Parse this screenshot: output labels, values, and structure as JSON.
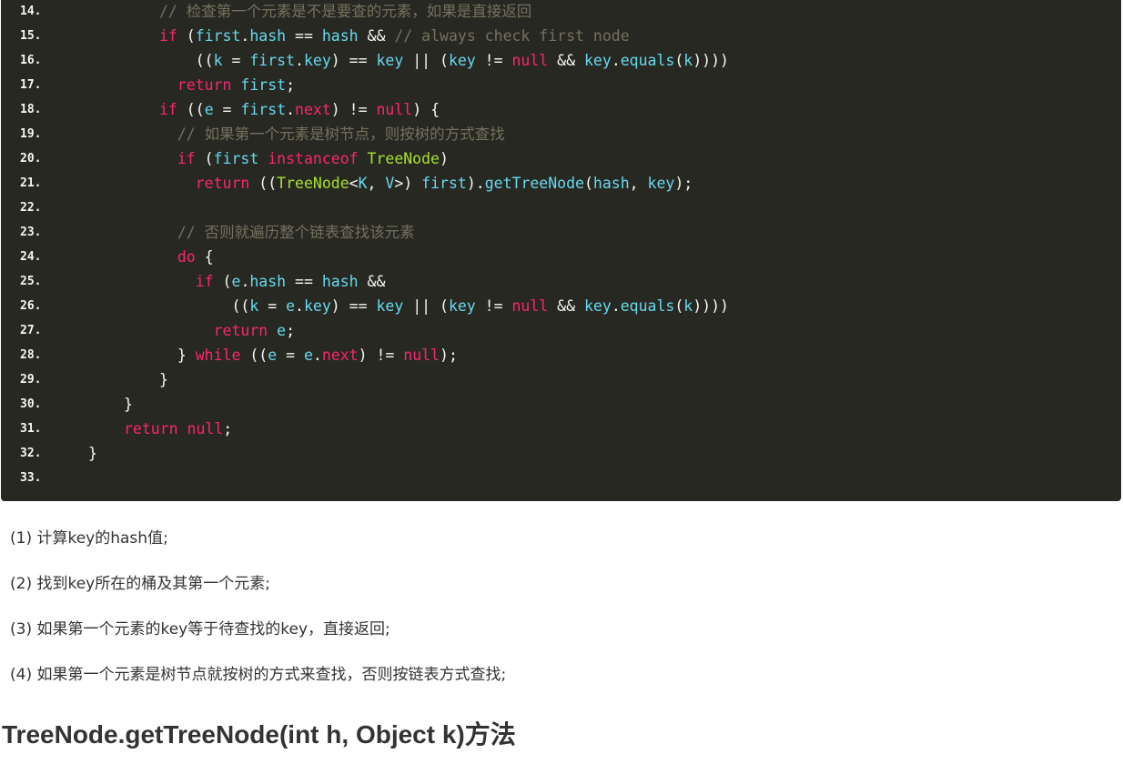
{
  "code": {
    "lines": [
      {
        "n": "14.",
        "tokens": [
          {
            "c": "c",
            "t": "// 检查第一个元素是不是要查的元素，如果是直接返回"
          }
        ]
      },
      {
        "n": "15.",
        "tokens": [
          {
            "c": "k",
            "t": "if"
          },
          {
            "c": "p",
            "t": " ("
          },
          {
            "c": "v",
            "t": "first"
          },
          {
            "c": "p",
            "t": "."
          },
          {
            "c": "v",
            "t": "hash"
          },
          {
            "c": "p",
            "t": " == "
          },
          {
            "c": "v",
            "t": "hash"
          },
          {
            "c": "p",
            "t": " && "
          },
          {
            "c": "c",
            "t": "// always check first node"
          }
        ]
      },
      {
        "n": "16.",
        "tokens": [
          {
            "c": "p",
            "t": "    (("
          },
          {
            "c": "v",
            "t": "k"
          },
          {
            "c": "p",
            "t": " = "
          },
          {
            "c": "v",
            "t": "first"
          },
          {
            "c": "p",
            "t": "."
          },
          {
            "c": "v",
            "t": "key"
          },
          {
            "c": "p",
            "t": ") == "
          },
          {
            "c": "v",
            "t": "key"
          },
          {
            "c": "p",
            "t": " || ("
          },
          {
            "c": "v",
            "t": "key"
          },
          {
            "c": "p",
            "t": " != "
          },
          {
            "c": "k",
            "t": "null"
          },
          {
            "c": "p",
            "t": " && "
          },
          {
            "c": "v",
            "t": "key"
          },
          {
            "c": "p",
            "t": "."
          },
          {
            "c": "v",
            "t": "equals"
          },
          {
            "c": "p",
            "t": "("
          },
          {
            "c": "v",
            "t": "k"
          },
          {
            "c": "p",
            "t": "))))"
          }
        ]
      },
      {
        "n": "17.",
        "tokens": [
          {
            "c": "p",
            "t": "  "
          },
          {
            "c": "k",
            "t": "return"
          },
          {
            "c": "p",
            "t": " "
          },
          {
            "c": "v",
            "t": "first"
          },
          {
            "c": "p",
            "t": ";"
          }
        ]
      },
      {
        "n": "18.",
        "tokens": [
          {
            "c": "k",
            "t": "if"
          },
          {
            "c": "p",
            "t": " (("
          },
          {
            "c": "v",
            "t": "e"
          },
          {
            "c": "p",
            "t": " = "
          },
          {
            "c": "v",
            "t": "first"
          },
          {
            "c": "p",
            "t": "."
          },
          {
            "c": "k",
            "t": "next"
          },
          {
            "c": "p",
            "t": ") != "
          },
          {
            "c": "k",
            "t": "null"
          },
          {
            "c": "p",
            "t": ") {"
          }
        ]
      },
      {
        "n": "19.",
        "tokens": [
          {
            "c": "p",
            "t": "  "
          },
          {
            "c": "c",
            "t": "// 如果第一个元素是树节点，则按树的方式查找"
          }
        ]
      },
      {
        "n": "20.",
        "tokens": [
          {
            "c": "p",
            "t": "  "
          },
          {
            "c": "k",
            "t": "if"
          },
          {
            "c": "p",
            "t": " ("
          },
          {
            "c": "v",
            "t": "first"
          },
          {
            "c": "p",
            "t": " "
          },
          {
            "c": "k",
            "t": "instanceof"
          },
          {
            "c": "p",
            "t": " "
          },
          {
            "c": "t",
            "t": "TreeNode"
          },
          {
            "c": "p",
            "t": ")"
          }
        ]
      },
      {
        "n": "21.",
        "tokens": [
          {
            "c": "p",
            "t": "    "
          },
          {
            "c": "k",
            "t": "return"
          },
          {
            "c": "p",
            "t": " (("
          },
          {
            "c": "t",
            "t": "TreeNode"
          },
          {
            "c": "p",
            "t": "<"
          },
          {
            "c": "v",
            "t": "K"
          },
          {
            "c": "p",
            "t": ", "
          },
          {
            "c": "v",
            "t": "V"
          },
          {
            "c": "p",
            "t": ">) "
          },
          {
            "c": "v",
            "t": "first"
          },
          {
            "c": "p",
            "t": ")."
          },
          {
            "c": "v",
            "t": "getTreeNode"
          },
          {
            "c": "p",
            "t": "("
          },
          {
            "c": "v",
            "t": "hash"
          },
          {
            "c": "p",
            "t": ", "
          },
          {
            "c": "v",
            "t": "key"
          },
          {
            "c": "p",
            "t": ");"
          }
        ]
      },
      {
        "n": "22.",
        "tokens": []
      },
      {
        "n": "23.",
        "tokens": [
          {
            "c": "p",
            "t": "  "
          },
          {
            "c": "c",
            "t": "// 否则就遍历整个链表查找该元素"
          }
        ]
      },
      {
        "n": "24.",
        "tokens": [
          {
            "c": "p",
            "t": "  "
          },
          {
            "c": "k",
            "t": "do"
          },
          {
            "c": "p",
            "t": " {"
          }
        ]
      },
      {
        "n": "25.",
        "tokens": [
          {
            "c": "p",
            "t": "    "
          },
          {
            "c": "k",
            "t": "if"
          },
          {
            "c": "p",
            "t": " ("
          },
          {
            "c": "v",
            "t": "e"
          },
          {
            "c": "p",
            "t": "."
          },
          {
            "c": "v",
            "t": "hash"
          },
          {
            "c": "p",
            "t": " == "
          },
          {
            "c": "v",
            "t": "hash"
          },
          {
            "c": "p",
            "t": " &&"
          }
        ]
      },
      {
        "n": "26.",
        "tokens": [
          {
            "c": "p",
            "t": "        (("
          },
          {
            "c": "v",
            "t": "k"
          },
          {
            "c": "p",
            "t": " = "
          },
          {
            "c": "v",
            "t": "e"
          },
          {
            "c": "p",
            "t": "."
          },
          {
            "c": "v",
            "t": "key"
          },
          {
            "c": "p",
            "t": ") == "
          },
          {
            "c": "v",
            "t": "key"
          },
          {
            "c": "p",
            "t": " || ("
          },
          {
            "c": "v",
            "t": "key"
          },
          {
            "c": "p",
            "t": " != "
          },
          {
            "c": "k",
            "t": "null"
          },
          {
            "c": "p",
            "t": " && "
          },
          {
            "c": "v",
            "t": "key"
          },
          {
            "c": "p",
            "t": "."
          },
          {
            "c": "v",
            "t": "equals"
          },
          {
            "c": "p",
            "t": "("
          },
          {
            "c": "v",
            "t": "k"
          },
          {
            "c": "p",
            "t": "))))"
          }
        ]
      },
      {
        "n": "27.",
        "tokens": [
          {
            "c": "p",
            "t": "      "
          },
          {
            "c": "k",
            "t": "return"
          },
          {
            "c": "p",
            "t": " "
          },
          {
            "c": "v",
            "t": "e"
          },
          {
            "c": "p",
            "t": ";"
          }
        ]
      },
      {
        "n": "28.",
        "tokens": [
          {
            "c": "p",
            "t": "  } "
          },
          {
            "c": "k",
            "t": "while"
          },
          {
            "c": "p",
            "t": " (("
          },
          {
            "c": "v",
            "t": "e"
          },
          {
            "c": "p",
            "t": " = "
          },
          {
            "c": "v",
            "t": "e"
          },
          {
            "c": "p",
            "t": "."
          },
          {
            "c": "k",
            "t": "next"
          },
          {
            "c": "p",
            "t": ") != "
          },
          {
            "c": "k",
            "t": "null"
          },
          {
            "c": "p",
            "t": ");"
          }
        ]
      },
      {
        "n": "29.",
        "tokens": [
          {
            "c": "p",
            "t": "}"
          }
        ]
      },
      {
        "n": "30.",
        "tokens": [
          {
            "c": "p",
            "t": "}"
          }
        ]
      },
      {
        "n": "31.",
        "tokens": [
          {
            "c": "k",
            "t": "return"
          },
          {
            "c": "p",
            "t": " "
          },
          {
            "c": "k",
            "t": "null"
          },
          {
            "c": "p",
            "t": ";"
          }
        ]
      },
      {
        "n": "32.",
        "tokens": [
          {
            "c": "p",
            "t": "}"
          }
        ]
      },
      {
        "n": "33.",
        "tokens": []
      }
    ]
  },
  "notes": [
    "(1) 计算key的hash值;",
    "(2) 找到key所在的桶及其第一个元素;",
    "(3) 如果第一个元素的key等于待查找的key，直接返回;",
    "(4) 如果第一个元素是树节点就按树的方式来查找，否则按链表方式查找;"
  ],
  "heading": "TreeNode.getTreeNode(int h, Object k)方法",
  "colors": {
    "code_bg": "#282822",
    "plain": "#f8f8f2",
    "keyword": "#f92672",
    "identifier": "#66d9ef",
    "comment": "#75715e",
    "type": "#a6e22e"
  }
}
